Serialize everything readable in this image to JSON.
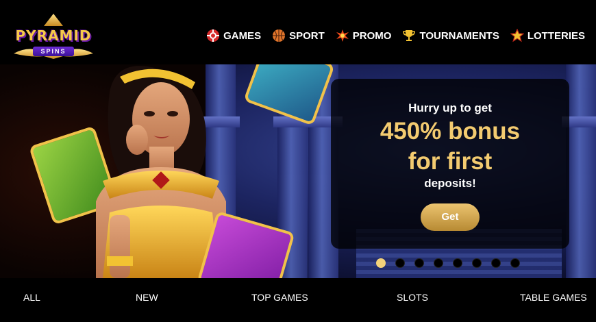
{
  "logo": {
    "title": "PYRAMID",
    "subtitle": "SPINS"
  },
  "nav": {
    "items": [
      {
        "label": "GAMES",
        "icon": "poker-chip-icon"
      },
      {
        "label": "SPORT",
        "icon": "basketball-icon"
      },
      {
        "label": "PROMO",
        "icon": "burst-icon"
      },
      {
        "label": "TOURNAMENTS",
        "icon": "trophy-icon"
      },
      {
        "label": "LOTTERIES",
        "icon": "star-icon"
      }
    ]
  },
  "banner": {
    "intro": "Hurry up to get",
    "headline_line1": "450% bonus",
    "headline_line2": "for first",
    "tail": "deposits!",
    "cta_label": "Get",
    "slide_count": 8,
    "active_slide": 1
  },
  "tabs": [
    "ALL",
    "NEW",
    "TOP GAMES",
    "SLOTS",
    "TABLE GAMES"
  ],
  "colors": {
    "accent_gold": "#f3cb70",
    "button_gold": "#d4a64e",
    "background": "#000000"
  }
}
